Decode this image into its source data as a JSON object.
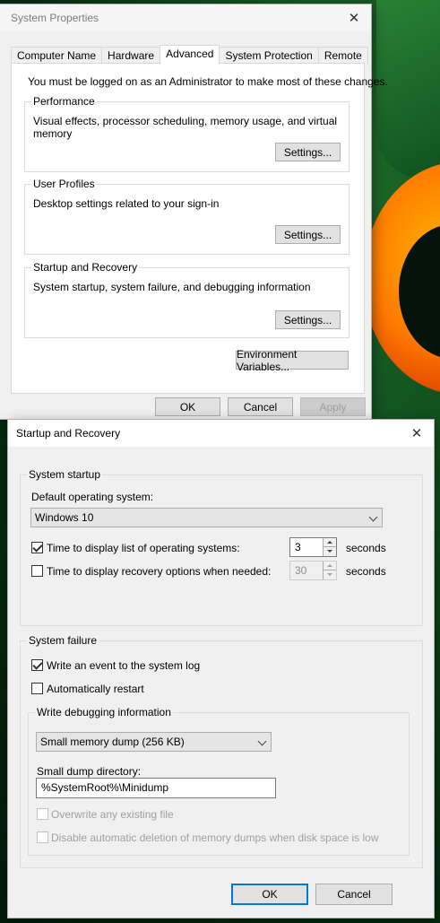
{
  "system_properties": {
    "title": "System Properties",
    "tabs": [
      "Computer Name",
      "Hardware",
      "Advanced",
      "System Protection",
      "Remote"
    ],
    "active_tab": "Advanced",
    "admin_note": "You must be logged on as an Administrator to make most of these changes.",
    "performance": {
      "label": "Performance",
      "description": "Visual effects, processor scheduling, memory usage, and virtual memory",
      "button": "Settings..."
    },
    "user_profiles": {
      "label": "User Profiles",
      "description": "Desktop settings related to your sign-in",
      "button": "Settings..."
    },
    "startup_recovery": {
      "label": "Startup and Recovery",
      "description": "System startup, system failure, and debugging information",
      "button": "Settings..."
    },
    "env_button": "Environment Variables...",
    "ok": "OK",
    "cancel": "Cancel",
    "apply": "Apply"
  },
  "startup_recovery_dialog": {
    "title": "Startup and Recovery",
    "system_startup": {
      "label": "System startup",
      "default_os_label": "Default operating system:",
      "default_os_value": "Windows 10",
      "time_list_label": "Time to display list of operating systems:",
      "time_list_checked": true,
      "time_list_value": "3",
      "time_recovery_label": "Time to display recovery options when needed:",
      "time_recovery_checked": false,
      "time_recovery_value": "30",
      "seconds": "seconds"
    },
    "system_failure": {
      "label": "System failure",
      "write_event_label": "Write an event to the system log",
      "write_event_checked": true,
      "auto_restart_label": "Automatically restart",
      "auto_restart_checked": false,
      "debug_group_label": "Write debugging information",
      "dump_type_value": "Small memory dump (256 KB)",
      "dump_dir_label": "Small dump directory:",
      "dump_dir_value": "%SystemRoot%\\Minidump",
      "overwrite_label": "Overwrite any existing file",
      "disable_delete_label": "Disable automatic deletion of memory dumps when disk space is low"
    },
    "ok": "OK",
    "cancel": "Cancel"
  }
}
